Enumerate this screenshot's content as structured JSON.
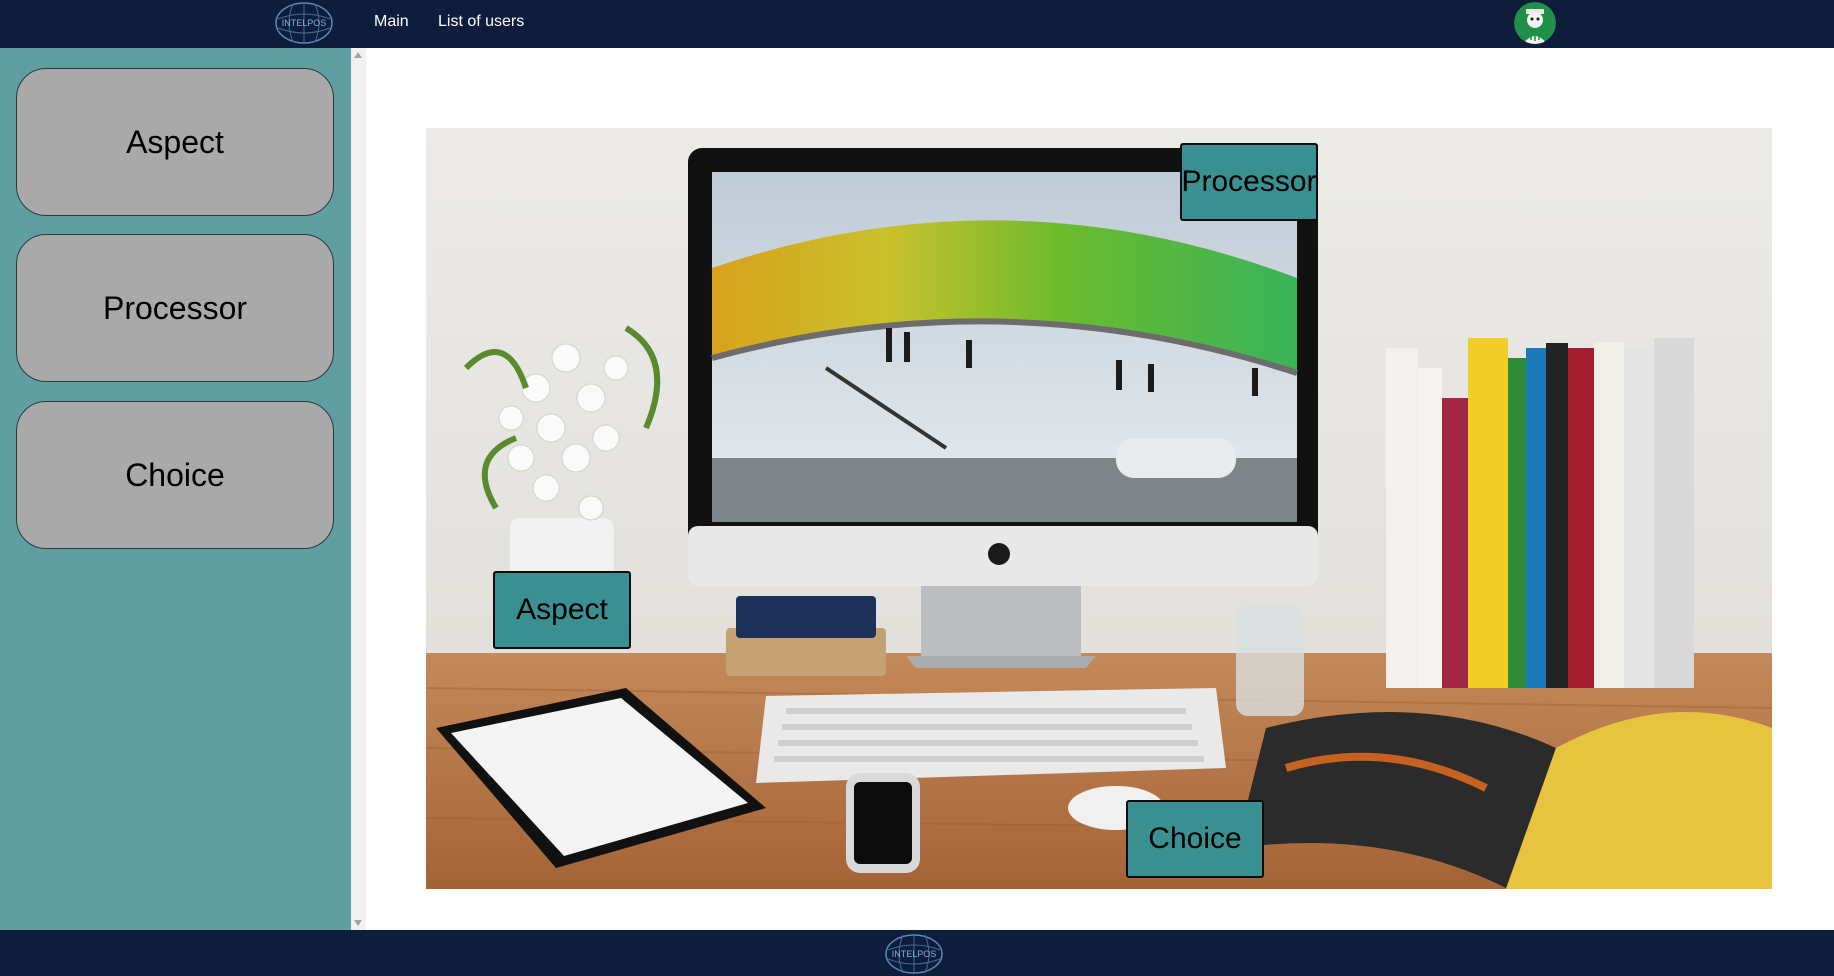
{
  "header": {
    "logo_text": "INTELPOS",
    "nav": [
      {
        "label": "Main"
      },
      {
        "label": "List of users"
      }
    ]
  },
  "sidebar": {
    "items": [
      {
        "label": "Aspect"
      },
      {
        "label": "Processor"
      },
      {
        "label": "Choice"
      }
    ]
  },
  "scene": {
    "hotspots": [
      {
        "label": "Processor"
      },
      {
        "label": "Aspect"
      },
      {
        "label": "Choice"
      }
    ]
  },
  "footer": {
    "logo_text": "INTELPOS"
  },
  "colors": {
    "header_bg": "#0f1d3d",
    "sidebar_bg": "#5f9fa1",
    "sidebar_button": "#a9a9a9",
    "hotspot": "#3a9090"
  }
}
